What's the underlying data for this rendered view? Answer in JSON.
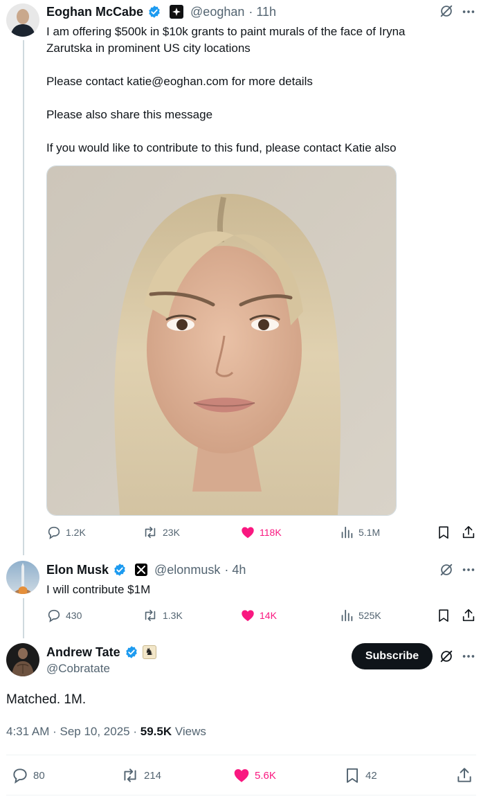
{
  "tweet1": {
    "name": "Eoghan McCabe",
    "handle": "@eoghan",
    "time": "· 11h",
    "lines": [
      "I am offering $500k in $10k grants to paint murals of the face of Iryna",
      "Zarutska in prominent US city locations",
      "Please contact katie@eoghan.com for more details",
      "Please also share this message",
      "If you would like to contribute to this fund, please contact Katie also"
    ],
    "actions": {
      "replies": "1.2K",
      "reposts": "23K",
      "likes": "118K",
      "views": "5.1M"
    }
  },
  "tweet2": {
    "name": "Elon Musk",
    "handle": "@elonmusk",
    "time": "· 4h",
    "text": "I will contribute $1M",
    "actions": {
      "replies": "430",
      "reposts": "1.3K",
      "likes": "14K",
      "views": "525K"
    }
  },
  "tweet3": {
    "name": "Andrew Tate",
    "handle": "@Cobratate",
    "subscribe_label": "Subscribe",
    "text": "Matched. 1M.",
    "timestamp": "4:31 AM · Sep 10, 2025 ·",
    "views_count": "59.5K",
    "views_label": "Views",
    "actions": {
      "replies": "80",
      "reposts": "214",
      "likes": "5.6K",
      "bookmarks": "42"
    }
  },
  "icons": {
    "verified": "verified-badge-icon",
    "grok": "grok-icon",
    "more": "more-icon",
    "reply": "reply-icon",
    "repost": "repost-icon",
    "like": "heart-icon",
    "views": "views-icon",
    "bookmark": "bookmark-icon",
    "share": "share-icon"
  },
  "colors": {
    "like": "#f91880",
    "verified": "#1d9bf0",
    "text": "#0f1419",
    "secondary": "#536471"
  }
}
